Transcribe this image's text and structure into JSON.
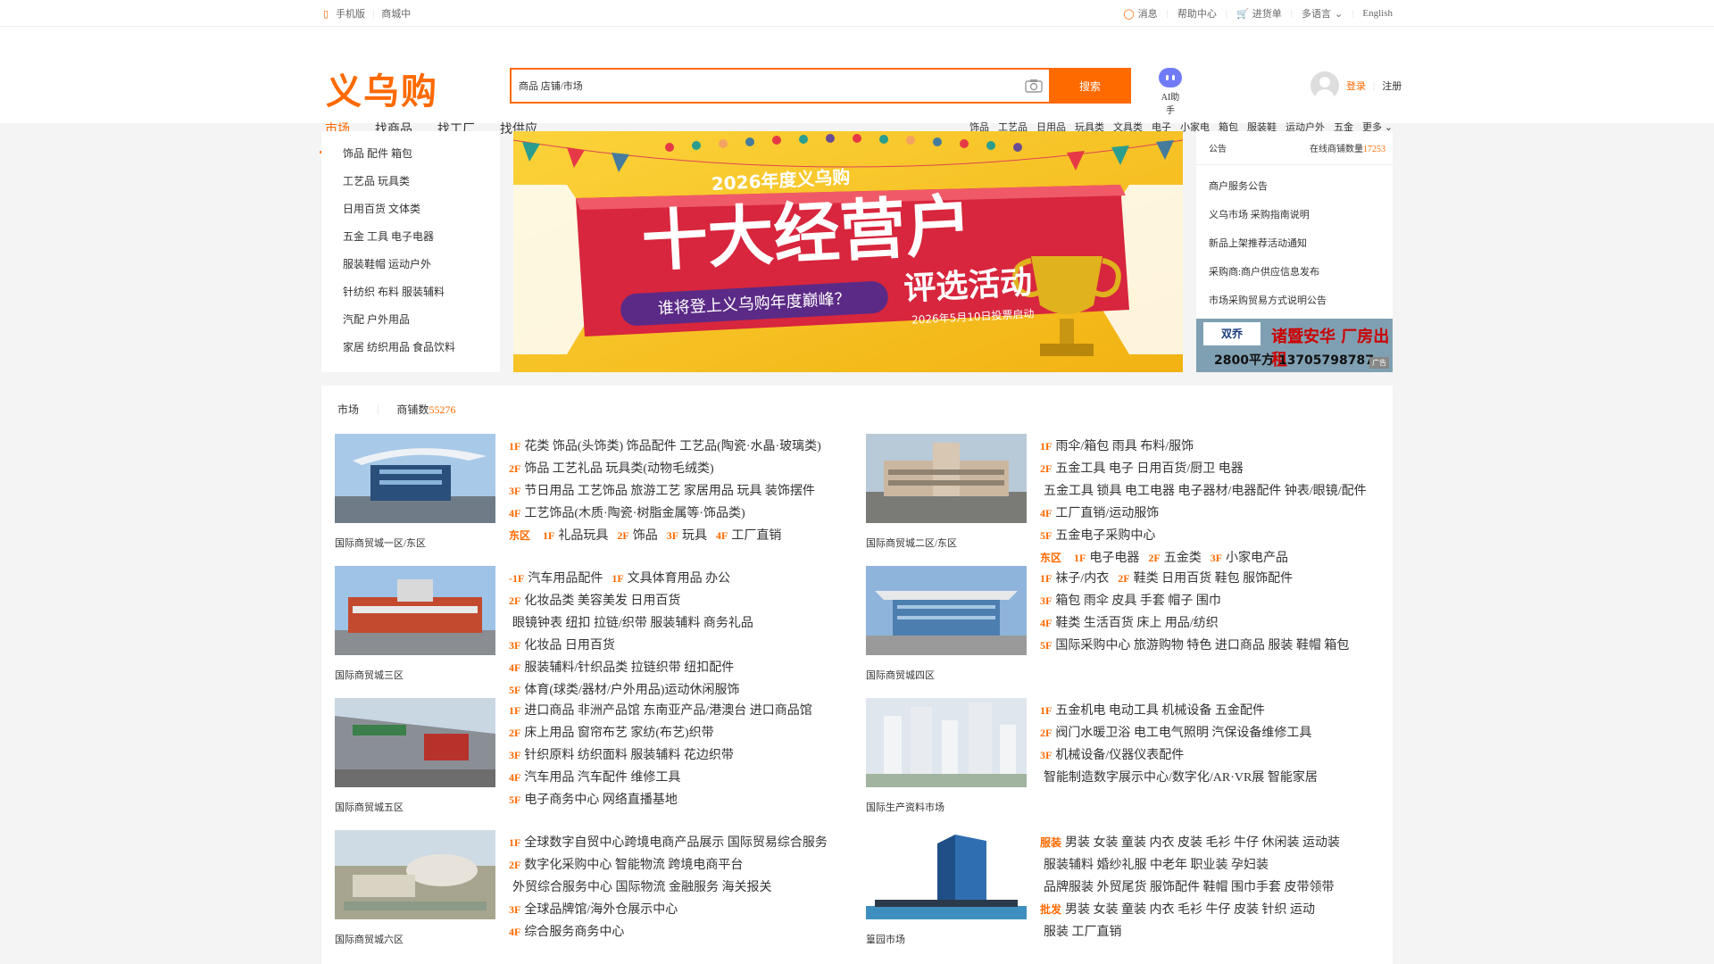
{
  "colors": {
    "accent": "#ff6a00",
    "ai": "#6f7bf7"
  },
  "topbar": {
    "left": [
      "手机版",
      "商城中"
    ],
    "right": {
      "msg": "消息",
      "help": "帮助中心",
      "cart": "进货单",
      "lang_select": "多语言",
      "english": "English"
    }
  },
  "header": {
    "logo": "义乌购",
    "search_value": "商品 店铺/市场",
    "search_button": "搜索",
    "ai_label": "AI助手",
    "login": "登录",
    "register": "注册"
  },
  "nav": {
    "tabs": [
      "市场",
      "找商品",
      "找工厂",
      "找供应"
    ],
    "categories": [
      "饰品",
      "工艺品",
      "日用品",
      "玩具类",
      "文具类",
      "电子",
      "小家电",
      "箱包",
      "服装鞋",
      "运动户外",
      "五金",
      "更多"
    ]
  },
  "category_menu": [
    "饰品 配件 箱包",
    "工艺品 玩具类",
    "日用百货 文体类",
    "五金 工具 电子电器",
    "服装鞋帽 运动户外",
    "针纺织 布料 服装辅料",
    "汽配 户外用品",
    "家居 纺织用品 食品饮料"
  ],
  "banner": {
    "top_text": "2026年度义乌购",
    "big_text": "十大经营户",
    "sub_text": "评选活动",
    "question": "谁将登上义乌购年度巅峰？",
    "date": "2026年5月10日投票启动"
  },
  "info_panel": {
    "title": "公告",
    "count_label": "在线商铺数量",
    "count": "17253",
    "items": [
      "商户服务公告",
      "义乌市场 采购指南说明",
      "新品上架推荐活动通知",
      "采购商:商户供应信息发布",
      "市场采购贸易方式说明公告"
    ],
    "ad": {
      "logo": "双乔",
      "title": "诸暨安华 厂房出租",
      "phone": "2800平方 13705798787",
      "tag": "广告"
    }
  },
  "market": {
    "title": "市场",
    "count_label": "商铺数",
    "count": "55276",
    "items": [
      {
        "name": "国际商贸城一区/东区",
        "rows": [
          [
            [
              "1F",
              "花类 饰品(头饰类) 饰品配件 工艺品(陶瓷·水晶·玻璃类)"
            ]
          ],
          [
            [
              "2F",
              "饰品 工艺礼品 玩具类(动物毛绒类)"
            ]
          ],
          [
            [
              "3F",
              "节日用品 工艺饰品 旅游工艺 家居用品 玩具 装饰摆件"
            ]
          ],
          [
            [
              "4F",
              "工艺饰品(木质·陶瓷·树脂金属等·饰品类)"
            ]
          ],
          [
            [
              "东区",
              ""
            ],
            [
              "1F",
              "礼品玩具"
            ],
            [
              "2F",
              "饰品"
            ],
            [
              "3F",
              "玩具"
            ],
            [
              "4F",
              "工厂直销"
            ]
          ]
        ]
      },
      {
        "name": "国际商贸城二区/东区",
        "rows": [
          [
            [
              "1F",
              "雨伞/箱包 雨具 布料/服饰"
            ],
            [
              "2F",
              "五金工具 电子 日用百货/厨卫 电器"
            ]
          ],
          [
            [
              "",
              "五金工具 锁具 电工电器 电子器材/电器配件 钟表/眼镜/配件"
            ],
            [
              "4F",
              "工厂直销/运动服饰"
            ]
          ],
          [
            [
              "5F",
              "五金电子采购中心"
            ]
          ],
          [
            [
              "东区",
              ""
            ],
            [
              "1F",
              "电子电器"
            ],
            [
              "2F",
              "五金类"
            ],
            [
              "3F",
              "小家电产品"
            ]
          ]
        ]
      },
      {
        "name": "国际商贸城三区",
        "rows": [
          [
            [
              "-1F",
              "汽车用品配件"
            ],
            [
              "1F",
              "文具体育用品 办公"
            ],
            [
              "2F",
              "化妆品类 美容美发 日用百货"
            ]
          ],
          [
            [
              "",
              "眼镜钟表 纽扣 拉链/织带 服装辅料 商务礼品"
            ],
            [
              "3F",
              "化妆品 日用百货"
            ]
          ],
          [
            [
              "4F",
              "服装辅料/针织品类 拉链织带 纽扣配件"
            ],
            [
              "5F",
              "体育(球类/器材/户外用品)运动休闲服饰"
            ]
          ]
        ]
      },
      {
        "name": "国际商贸城四区",
        "rows": [
          [
            [
              "1F",
              "袜子/内衣"
            ],
            [
              "2F",
              "鞋类 日用百货 鞋包 服饰配件"
            ]
          ],
          [
            [
              "3F",
              "箱包 雨伞 皮具 手套 帽子 围巾"
            ],
            [
              "4F",
              "鞋类 生活百货 床上 用品/纺织"
            ]
          ],
          [
            [
              "5F",
              "国际采购中心 旅游购物 特色 进口商品 服装 鞋帽 箱包"
            ]
          ]
        ]
      },
      {
        "name": "国际商贸城五区",
        "rows": [
          [
            [
              "1F",
              "进口商品 非洲产品馆 东南亚产品/港澳台 进口商品馆"
            ]
          ],
          [
            [
              "2F",
              "床上用品 窗帘布艺 家纺(布艺)织带"
            ]
          ],
          [
            [
              "3F",
              "针织原料 纺织面料 服装辅料 花边织带"
            ],
            [
              "4F",
              "汽车用品 汽车配件 维修工具"
            ]
          ],
          [
            [
              "5F",
              "电子商务中心 网络直播基地"
            ]
          ]
        ]
      },
      {
        "name": "国际生产资料市场",
        "rows": [
          [
            [
              "1F",
              "五金机电 电动工具 机械设备 五金配件"
            ]
          ],
          [
            [
              "2F",
              "阀门水暖卫浴 电工电气照明 汽保设备维修工具"
            ],
            [
              "3F",
              "机械设备/仪器仪表配件"
            ]
          ],
          [
            [
              "",
              "智能制造数字展示中心/数字化/AR·VR展 智能家居"
            ]
          ]
        ]
      },
      {
        "name": "国际商贸城六区",
        "rows": [
          [
            [
              "1F",
              "全球数字自贸中心跨境电商产品展示 国际贸易综合服务"
            ],
            [
              "2F",
              "数字化采购中心 智能物流 跨境电商平台"
            ]
          ],
          [
            [
              "",
              "外贸综合服务中心 国际物流 金融服务 海关报关"
            ],
            [
              "3F",
              "全球品牌馆/海外仓展示中心"
            ]
          ],
          [
            [
              "4F",
              "综合服务商务中心"
            ]
          ]
        ]
      },
      {
        "name": "篁园市场",
        "rows": [
          [
            [
              "服装",
              "男装 女装 童装 内衣 皮装 毛衫 牛仔 休闲装 运动装"
            ]
          ],
          [
            [
              "",
              "服装辅料 婚纱礼服 中老年 职业装 孕妇装"
            ]
          ],
          [
            [
              "",
              "品牌服装 外贸尾货 服饰配件 鞋帽 围巾手套 皮带领带"
            ]
          ],
          [
            [
              "批发",
              "男装 女装 童装 内衣 毛衫 牛仔 皮装 针织 运动"
            ],
            [
              "",
              "服装 工厂直销"
            ]
          ]
        ]
      }
    ]
  }
}
